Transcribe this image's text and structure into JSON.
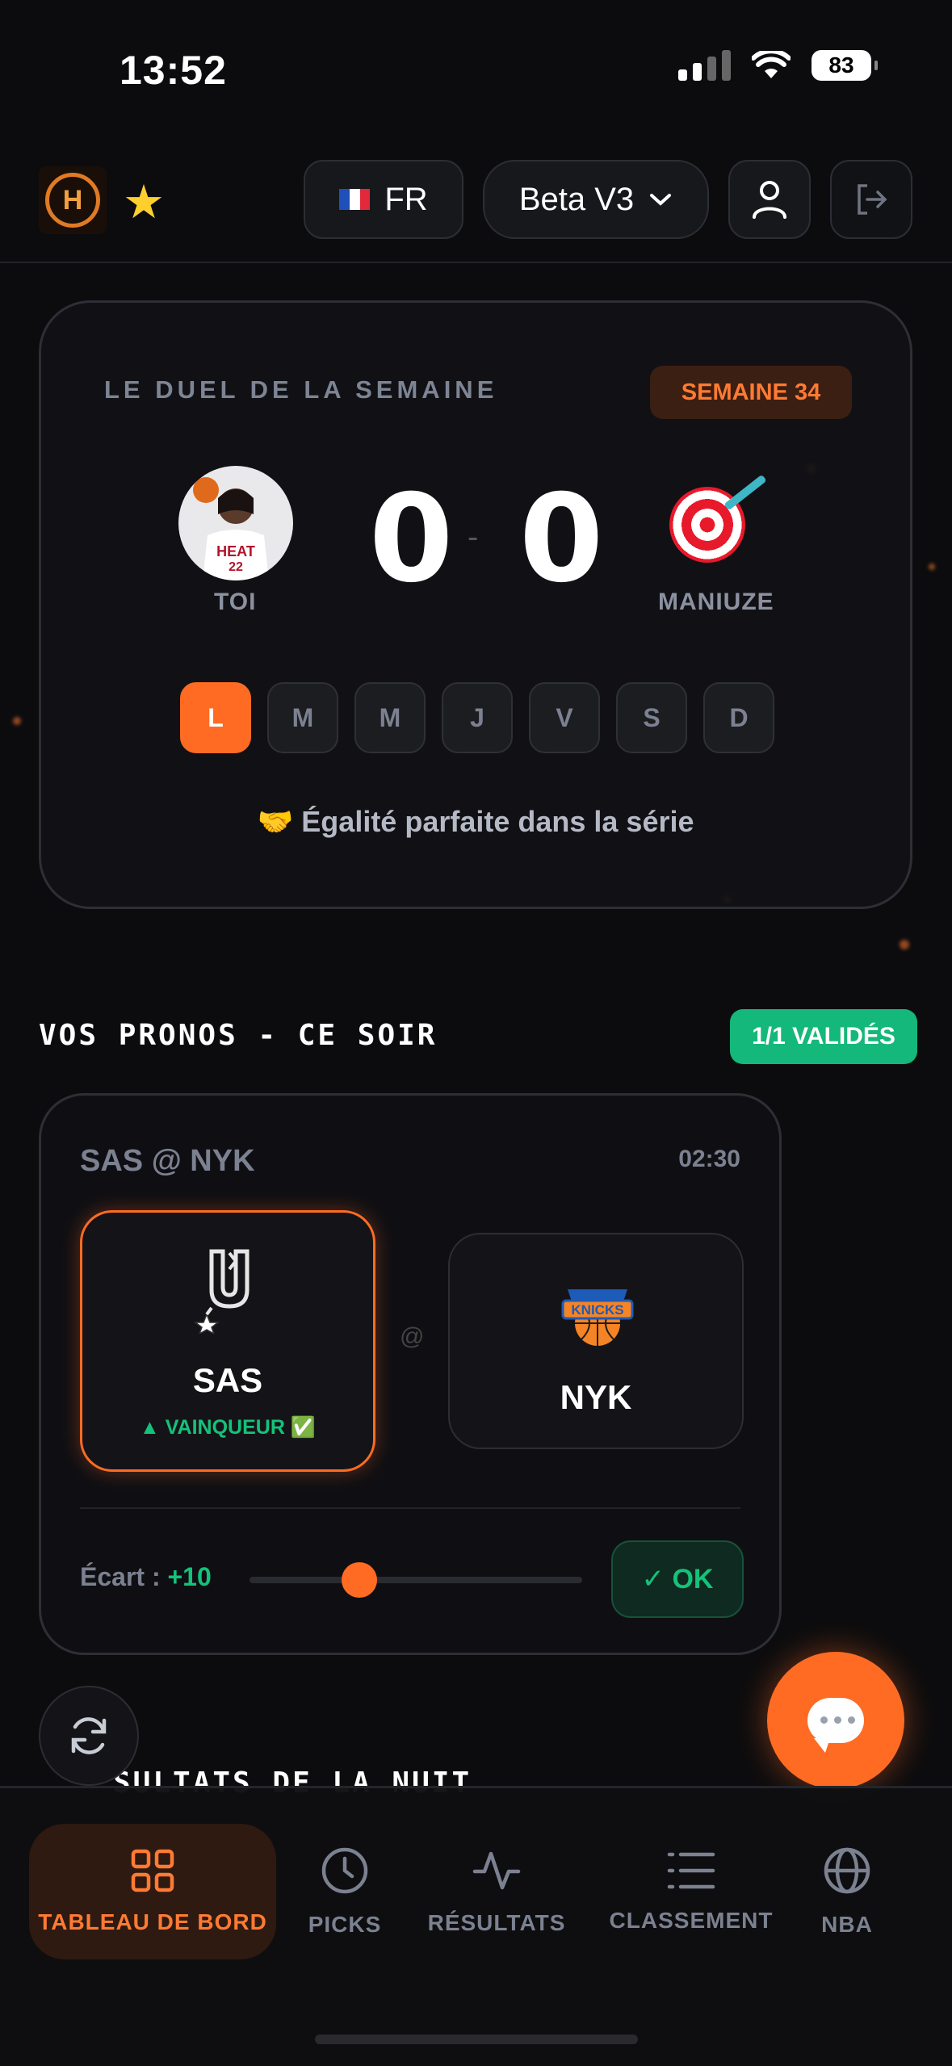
{
  "status_bar": {
    "time": "13:52",
    "battery": "83"
  },
  "header": {
    "language": "FR",
    "version": "Beta V3"
  },
  "duel": {
    "title": "LE DUEL DE LA SEMAINE",
    "week": "SEMAINE 34",
    "player_left": "TOI",
    "player_right": "MANIUZE",
    "score_left": "0",
    "score_right": "0",
    "separator": "-",
    "days": [
      "L",
      "M",
      "M",
      "J",
      "V",
      "S",
      "D"
    ],
    "active_day": 0,
    "message": "🤝 Égalité parfaite dans la série"
  },
  "picks": {
    "section_title": "VOS PRONOS - CE SOIR",
    "validated_badge": "1/1 VALIDÉS",
    "match": {
      "title": "SAS @ NYK",
      "time": "02:30",
      "home_team": "SAS",
      "away_team": "NYK",
      "separator": "@",
      "winner_label": "▲ VAINQUEUR ✅",
      "ecart_label": "Écart :",
      "ecart_value": "+10",
      "slider_fraction": 0.33,
      "ok_label": "✓ OK"
    }
  },
  "next_section_partial": "SULTATS DE LA NUIT",
  "nav": {
    "items": [
      {
        "label": "TABLEAU DE BORD",
        "icon": "grid-icon",
        "active": true
      },
      {
        "label": "PICKS",
        "icon": "clock-icon",
        "active": false
      },
      {
        "label": "RÉSULTATS",
        "icon": "activity-icon",
        "active": false
      },
      {
        "label": "CLASSEMENT",
        "icon": "list-icon",
        "active": false
      },
      {
        "label": "NBA",
        "icon": "globe-icon",
        "active": false
      }
    ]
  },
  "colors": {
    "accent": "#ff6b23",
    "success": "#14c27a",
    "background": "#0c0c0e"
  }
}
